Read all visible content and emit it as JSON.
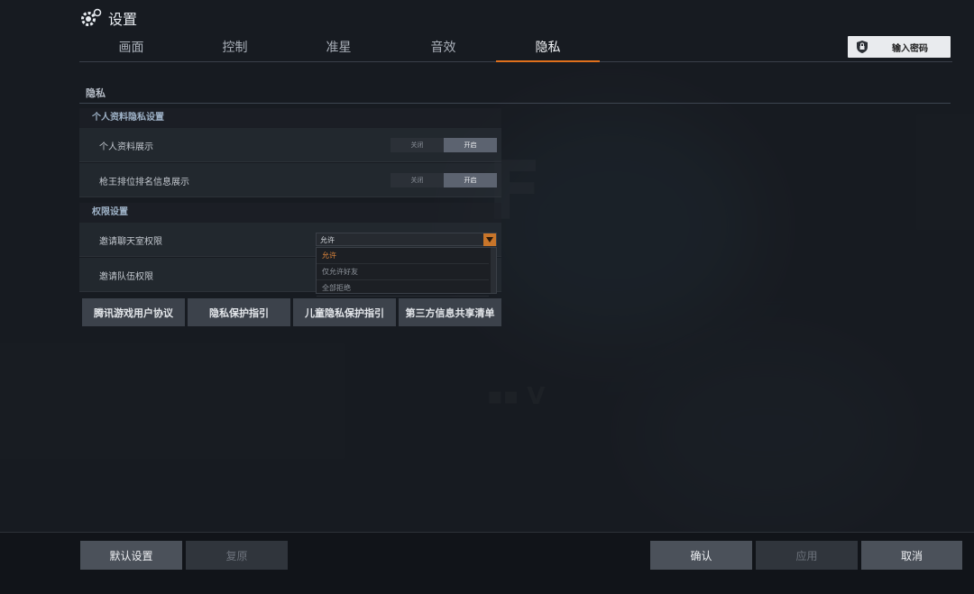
{
  "header": {
    "title": "设置"
  },
  "tabs": [
    {
      "label": "画面"
    },
    {
      "label": "控制"
    },
    {
      "label": "准星"
    },
    {
      "label": "音效"
    },
    {
      "label": "隐私",
      "active": true
    }
  ],
  "password_button": {
    "label": "输入密码"
  },
  "section": {
    "title": "隐私"
  },
  "profile_group": {
    "title": "个人资料隐私设置",
    "rows": [
      {
        "label": "个人资料展示",
        "off": "关闭",
        "on": "开启",
        "value": "on"
      },
      {
        "label": "枪王排位排名信息展示",
        "off": "关闭",
        "on": "开启",
        "value": "on"
      }
    ]
  },
  "permission_group": {
    "title": "权限设置",
    "rows": [
      {
        "label": "邀请聊天室权限"
      },
      {
        "label": "邀请队伍权限"
      }
    ],
    "select": {
      "value": "允许",
      "options": [
        "允许",
        "仅允许好友",
        "全部拒绝"
      ]
    }
  },
  "links": [
    {
      "label": "腾讯游戏用户协议"
    },
    {
      "label": "隐私保护指引"
    },
    {
      "label": "儿童隐私保护指引"
    },
    {
      "label": "第三方信息共享清单"
    }
  ],
  "footer": {
    "default_label": "默认设置",
    "restore_label": "复原",
    "confirm_label": "确认",
    "apply_label": "应用",
    "cancel_label": "取消"
  },
  "colors": {
    "accent": "#e0701c",
    "background": "#1c2026"
  }
}
